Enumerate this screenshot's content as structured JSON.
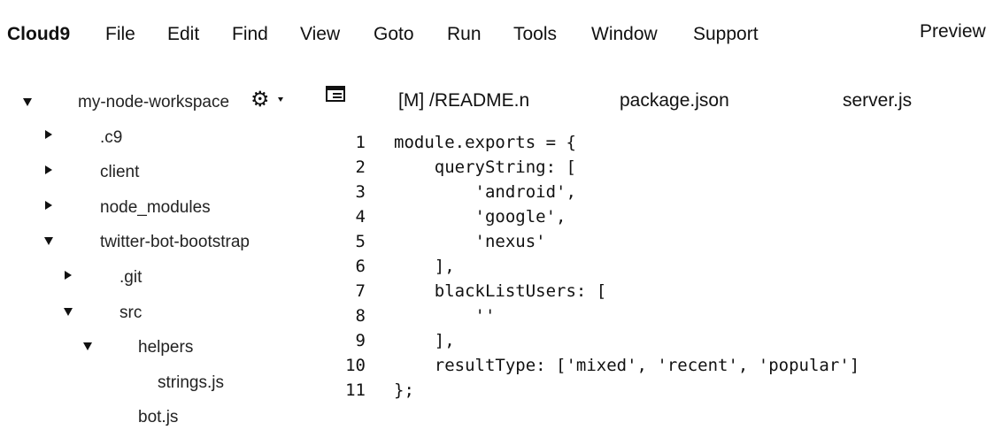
{
  "menubar": {
    "brand": "Cloud9",
    "items": [
      "File",
      "Edit",
      "Find",
      "View",
      "Goto",
      "Run",
      "Tools",
      "Window",
      "Support"
    ],
    "preview": "Preview"
  },
  "tree": {
    "workspace": "my-node-workspace",
    "nodes": [
      ".c9",
      "client",
      "node_modules",
      "twitter-bot-bootstrap",
      ".git",
      "src",
      "helpers",
      "strings.js",
      "bot.js"
    ]
  },
  "tabs": [
    "[M] /README.n",
    "package.json",
    "server.js"
  ],
  "editor": {
    "line_numbers": [
      "1",
      "2",
      "3",
      "4",
      "5",
      "6",
      "7",
      "8",
      "9",
      "10",
      "11"
    ],
    "lines": [
      "module.exports = {",
      "    queryString: [",
      "        'android',",
      "        'google',",
      "        'nexus'",
      "    ],",
      "    blackListUsers: [",
      "        ''",
      "    ],",
      "    resultType: ['mixed', 'recent', 'popular']",
      "};"
    ]
  }
}
